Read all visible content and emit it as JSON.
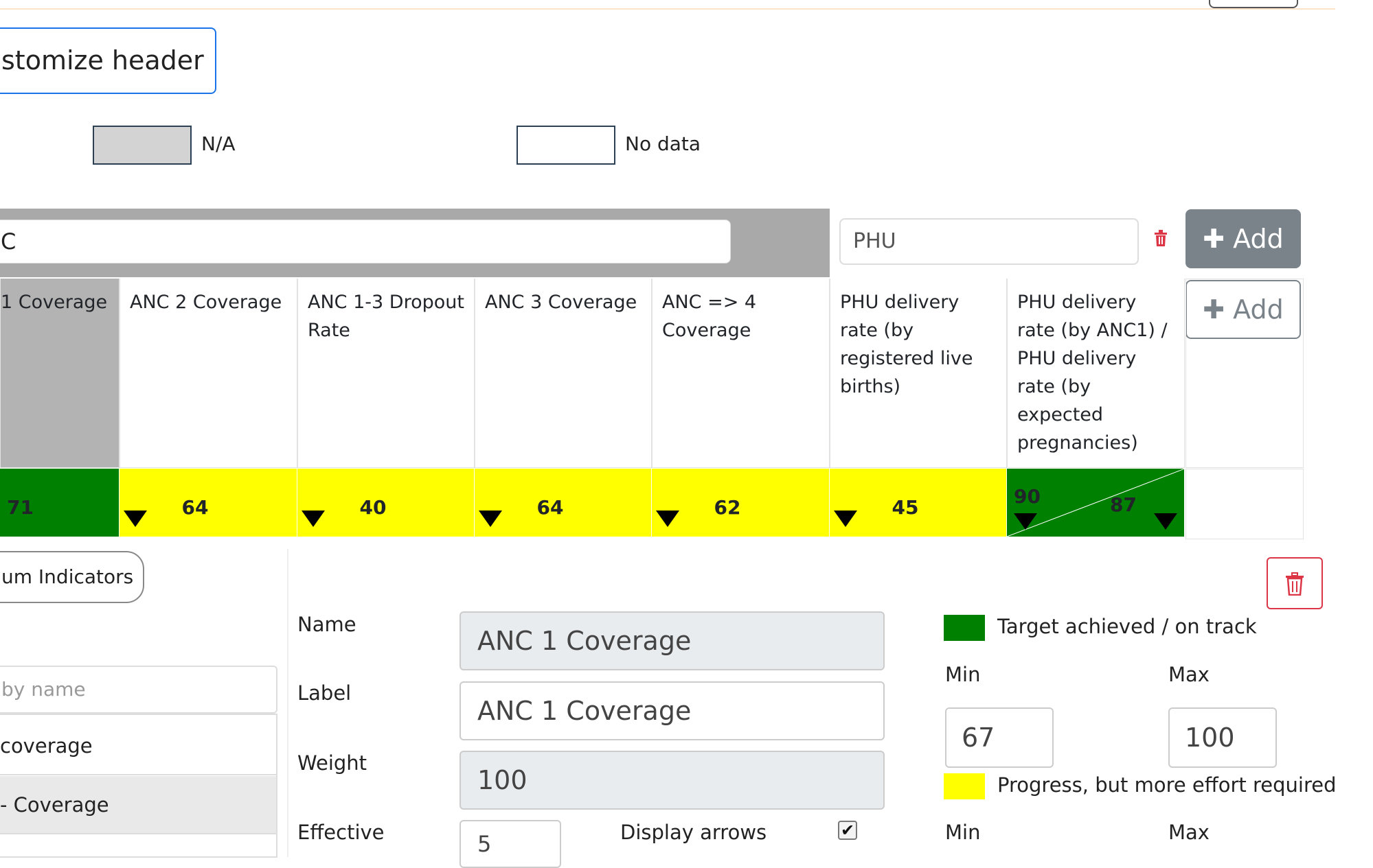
{
  "header": {
    "customize_label": "stomize header"
  },
  "legend": {
    "na_label": "N/A",
    "no_data_label": "No data"
  },
  "table": {
    "group_search_value": "C",
    "group2_value": "PHU",
    "add_label": "Add",
    "columns": [
      {
        "label": "1 Coverage",
        "value": "71",
        "color": "#008000"
      },
      {
        "label": "ANC 2 Coverage",
        "value": "64",
        "color": "#ffff00"
      },
      {
        "label": "ANC 1-3 Dropout Rate",
        "value": "40",
        "color": "#ffff00"
      },
      {
        "label": "ANC 3 Coverage",
        "value": "64",
        "color": "#ffff00"
      },
      {
        "label": "ANC => 4 Coverage",
        "value": "62",
        "color": "#ffff00"
      },
      {
        "label": "PHU delivery rate (by registered live births)",
        "value": "45",
        "color": "#ffff00"
      },
      {
        "label": "PHU delivery rate (by ANC1) / PHU delivery rate (by expected pregnancies)",
        "value_a": "90",
        "value_b": "87",
        "color": "#008000"
      }
    ]
  },
  "panel": {
    "indicators_btn": "um Indicators",
    "search_placeholder": "by name",
    "list_items": [
      "coverage",
      "- Coverage"
    ],
    "form": {
      "name_label": "Name",
      "name_value": "ANC 1 Coverage",
      "label_label": "Label",
      "label_value": "ANC 1 Coverage",
      "weight_label": "Weight",
      "weight_value": "100",
      "effective_label": "Effective",
      "effective_value": "5",
      "display_arrows_label": "Display arrows",
      "display_arrows_checked": true
    },
    "legend_items": [
      {
        "color": "#008000",
        "text": "Target achieved / on track",
        "min_label": "Min",
        "max_label": "Max",
        "min": "67",
        "max": "100"
      },
      {
        "color": "#ffff00",
        "text": "Progress, but more effort required",
        "min_label": "Min",
        "max_label": "Max"
      }
    ]
  }
}
